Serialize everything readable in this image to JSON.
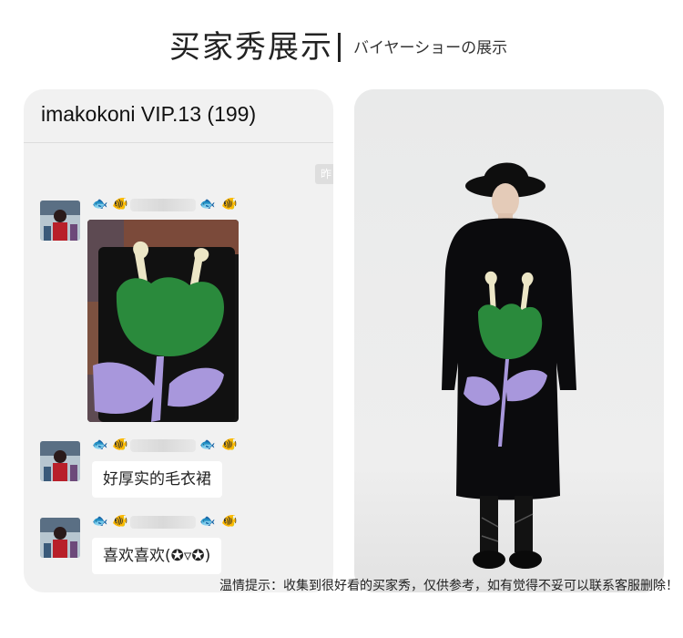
{
  "header": {
    "title": "买家秀展示",
    "subtitle": "バイヤーショーの展示"
  },
  "chat": {
    "title": "imakokoni VIP.13 (199)",
    "time_chip": "昨",
    "messages": [
      {
        "type": "image"
      },
      {
        "type": "text",
        "text": "好厚实的毛衣裙"
      },
      {
        "type": "text",
        "text": "喜欢喜欢(✪▿✪)"
      }
    ]
  },
  "footer": {
    "note": "温情提示：收集到很好看的买家秀，仅供参考，如有觉得不妥可以联系客服删除！"
  },
  "colors": {
    "sweater": "#0b0b0d",
    "tulip_green": "#2a8a3c",
    "stem_lavender": "#a897dc",
    "antenna_cream": "#ece6c6"
  }
}
